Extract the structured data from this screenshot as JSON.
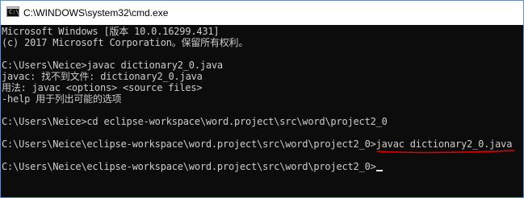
{
  "window": {
    "title": "C:\\WINDOWS\\system32\\cmd.exe"
  },
  "console": {
    "lines": [
      "Microsoft Windows [版本 10.0.16299.431]",
      "(c) 2017 Microsoft Corporation。保留所有权利。",
      "",
      "C:\\Users\\Neice>javac dictionary2_0.java",
      "javac: 找不到文件: dictionary2_0.java",
      "用法: javac <options> <source files>",
      "-help 用于列出可能的选项",
      "",
      "C:\\Users\\Neice>cd eclipse-workspace\\word.project\\src\\word\\project2_0",
      "",
      "C:\\Users\\Neice\\eclipse-workspace\\word.project\\src\\word\\project2_0>javac dictionary2_0.java",
      "",
      "C:\\Users\\Neice\\eclipse-workspace\\word.project\\src\\word\\project2_0>"
    ]
  },
  "colors": {
    "console_bg": "#0c0c0c",
    "console_text": "#cccccc",
    "annotation": "#e00000"
  },
  "icons": {
    "app": "cmd-console-icon"
  }
}
